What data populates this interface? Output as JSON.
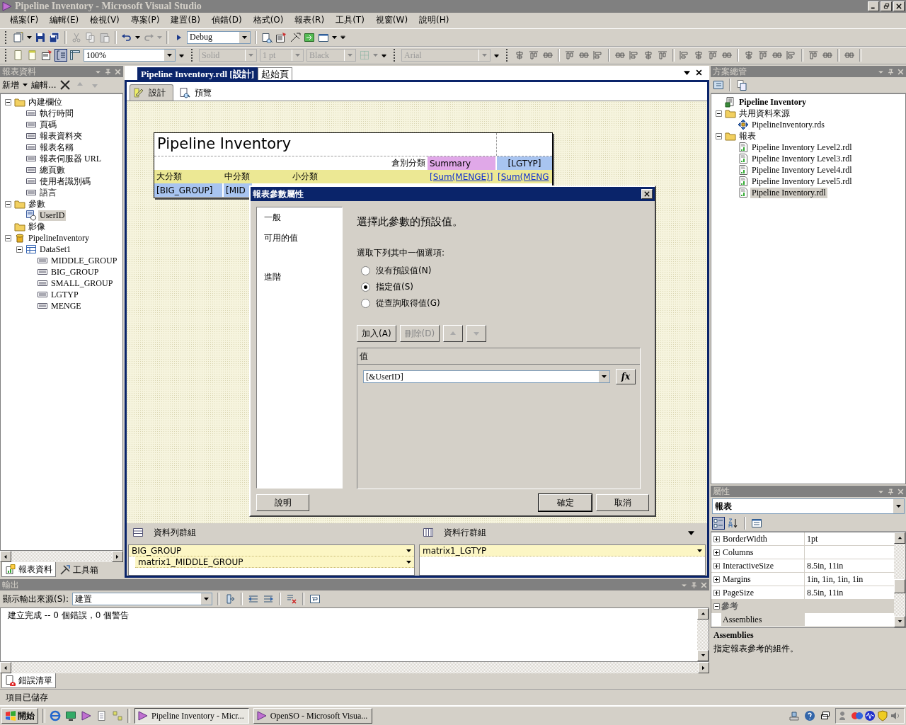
{
  "window": {
    "title": "Pipeline Inventory - Microsoft Visual Studio"
  },
  "menu": [
    "檔案(F)",
    "編輯(E)",
    "檢視(V)",
    "專案(P)",
    "建置(B)",
    "偵錯(D)",
    "格式(O)",
    "報表(R)",
    "工具(T)",
    "視窗(W)",
    "說明(H)"
  ],
  "standard_toolbar": {
    "configuration": "Debug"
  },
  "layout_toolbar": {
    "zoom": "100%"
  },
  "format_toolbar": {
    "line_style": {
      "value": "Solid",
      "disabled": true
    },
    "line_width": {
      "value": "1 pt",
      "disabled": true
    },
    "line_color": {
      "value": "Black",
      "disabled": true
    },
    "font": {
      "value": "Arial",
      "disabled": true
    }
  },
  "report_data": {
    "title": "報表資料",
    "toolbar": [
      "新增",
      "編輯..."
    ],
    "tree": [
      {
        "label": "內建欄位",
        "kind": "folder",
        "expanded": true,
        "selected": false,
        "children": [
          {
            "label": "執行時間",
            "kind": "field",
            "selected": false
          },
          {
            "label": "頁碼",
            "kind": "field",
            "selected": false
          },
          {
            "label": "報表資料夾",
            "kind": "field",
            "selected": false
          },
          {
            "label": "報表名稱",
            "kind": "field",
            "selected": false
          },
          {
            "label": "報表伺服器 URL",
            "kind": "field",
            "selected": false
          },
          {
            "label": "總頁數",
            "kind": "field",
            "selected": false
          },
          {
            "label": "使用者識別碼",
            "kind": "field",
            "selected": false
          },
          {
            "label": "語言",
            "kind": "field",
            "selected": false
          }
        ]
      },
      {
        "label": "參數",
        "kind": "folder",
        "expanded": true,
        "selected": false,
        "children": [
          {
            "label": "UserID",
            "kind": "parameter",
            "selected": true
          }
        ]
      },
      {
        "label": "影像",
        "kind": "folder",
        "selected": false
      },
      {
        "label": "PipelineInventory",
        "kind": "datasource",
        "expanded": true,
        "selected": false,
        "children": [
          {
            "label": "DataSet1",
            "kind": "dataset",
            "expanded": true,
            "selected": false,
            "children": [
              {
                "label": "MIDDLE_GROUP",
                "kind": "field",
                "selected": false
              },
              {
                "label": "BIG_GROUP",
                "kind": "field",
                "selected": false
              },
              {
                "label": "SMALL_GROUP",
                "kind": "field",
                "selected": false
              },
              {
                "label": "LGTYP",
                "kind": "field",
                "selected": false
              },
              {
                "label": "MENGE",
                "kind": "field",
                "selected": false
              }
            ]
          }
        ]
      }
    ],
    "tabs": [
      {
        "label": "報表資料",
        "selected": true
      },
      {
        "label": "工具箱",
        "selected": false
      }
    ]
  },
  "document_tabs": [
    {
      "label": "Pipeline Inventory.rdl [設計]",
      "selected": true
    },
    {
      "label": "起始頁",
      "selected": false
    }
  ],
  "view_tabs": [
    {
      "label": "設計",
      "selected": true
    },
    {
      "label": "預覽",
      "selected": false
    }
  ],
  "report": {
    "title": "Pipeline Inventory",
    "column_header": {
      "label": "倉別分類",
      "summary": "Summary",
      "group": "[LGTYP]"
    },
    "header_row": [
      "大分類",
      "中分類",
      "小分類"
    ],
    "totals": [
      "[Sum(MENGE)]",
      "[Sum(MENG"
    ],
    "detail_row": [
      "[BIG_GROUP]",
      "[MID"
    ]
  },
  "grouping": {
    "row_groups": {
      "title": "資料列群組",
      "items": [
        "BIG_GROUP",
        "matrix1_MIDDLE_GROUP"
      ]
    },
    "column_groups": {
      "title": "資料行群組",
      "items": [
        "matrix1_LGTYP"
      ]
    }
  },
  "dialog": {
    "title": "報表參數屬性",
    "nav": [
      "一般",
      "可用的值",
      "進階"
    ],
    "heading": "選擇此參數的預設值。",
    "prompt": "選取下列其中一個選項:",
    "options": [
      {
        "label": "沒有預設值(N)",
        "selected": false
      },
      {
        "label": "指定值(S)",
        "selected": true
      },
      {
        "label": "從查詢取得值(G)",
        "selected": false
      }
    ],
    "buttons": [
      {
        "label": "加入(A)",
        "disabled": false
      },
      {
        "label": "刪除(D)",
        "disabled": true
      }
    ],
    "move_buttons": [
      {
        "kind": "up",
        "disabled": true
      },
      {
        "kind": "down",
        "disabled": true
      }
    ],
    "grid": {
      "header": "值",
      "value": "[&UserID]",
      "formula": "fx"
    },
    "footer": {
      "help": "說明",
      "ok": "確定",
      "cancel": "取消"
    }
  },
  "solution_explorer": {
    "title": "方案總管",
    "tree": [
      {
        "label": "Pipeline Inventory",
        "kind": "project",
        "selected": false
      },
      {
        "label": "共用資料來源",
        "kind": "folder",
        "expanded": true,
        "selected": false,
        "children": [
          {
            "label": "PipelineInventory.rds",
            "kind": "datasource_file",
            "selected": false
          }
        ]
      },
      {
        "label": "報表",
        "kind": "folder",
        "expanded": true,
        "selected": false,
        "children": [
          {
            "label": "Pipeline Inventory Level2.rdl",
            "kind": "report",
            "selected": false
          },
          {
            "label": "Pipeline Inventory Level3.rdl",
            "kind": "report",
            "selected": false
          },
          {
            "label": "Pipeline Inventory Level4.rdl",
            "kind": "report",
            "selected": false
          },
          {
            "label": "Pipeline Inventory Level5.rdl",
            "kind": "report",
            "selected": false
          },
          {
            "label": "Pipeline Inventory.rdl",
            "kind": "report",
            "selected": true
          }
        ]
      }
    ]
  },
  "properties": {
    "title": "屬性",
    "object": "報表",
    "rows": [
      {
        "kind": "property",
        "name": "BorderWidth",
        "value": "1pt",
        "expanded": false
      },
      {
        "kind": "property",
        "name": "Columns",
        "expanded": false
      },
      {
        "kind": "property",
        "name": "InteractiveSize",
        "value": "8.5in, 11in",
        "expanded": false
      },
      {
        "kind": "property",
        "name": "Margins",
        "value": "1in, 1in, 1in, 1in",
        "expanded": false
      },
      {
        "kind": "property",
        "name": "PageSize",
        "value": "8.5in, 11in",
        "expanded": false
      },
      {
        "kind": "category",
        "name": "參考",
        "expanded": true
      },
      {
        "kind": "property",
        "name": "Assemblies"
      }
    ],
    "description": {
      "name": "Assemblies",
      "text": "指定報表參考的組件。"
    }
  },
  "output": {
    "title": "輸出",
    "source_label": "顯示輸出來源(S):",
    "source": "建置",
    "text": "建立完成 -- 0 個錯誤，0 個警告"
  },
  "bottom_tabs": [
    {
      "label": "錯誤清單",
      "selected": true
    }
  ],
  "status_bar": "項目已儲存",
  "taskbar": {
    "start": "開始",
    "tasks": [
      {
        "label": "Pipeline Inventory - Micr...",
        "selected": true
      },
      {
        "label": "OpenSO - Microsoft Visua...",
        "selected": false
      }
    ]
  }
}
